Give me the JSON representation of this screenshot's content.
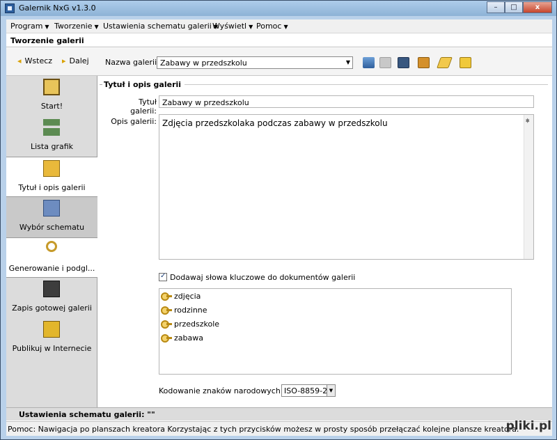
{
  "window": {
    "title": "Galernik NxG v1.3.0",
    "controls": {
      "minimize": "–",
      "maximize": "□",
      "close": "x"
    }
  },
  "menu": [
    {
      "label": "Program"
    },
    {
      "label": "Tworzenie"
    },
    {
      "label": "Ustawienia schematu galerii"
    },
    {
      "label": "Wyświetl"
    },
    {
      "label": "Pomoc"
    }
  ],
  "section_title": "Tworzenie galerii",
  "toolbar": {
    "back_label": "Wstecz",
    "next_label": "Dalej",
    "gallery_name_label": "Nazwa galerii:",
    "gallery_name_value": "Zabawy w przedszkolu",
    "icons": [
      "open-icon",
      "save-disabled-icon",
      "save-icon",
      "package-icon",
      "edit-icon",
      "tag-icon"
    ]
  },
  "sidebar": {
    "items": [
      {
        "label": "Start!",
        "icon": "film-icon"
      },
      {
        "label": "Lista grafik",
        "icon": "image-list-icon"
      },
      {
        "label": "Tytuł i opis galerii",
        "icon": "folder-open-icon"
      },
      {
        "label": "Wybór schematu",
        "icon": "schema-icon"
      },
      {
        "label": "Generowanie i podgl...",
        "icon": "magnifier-icon"
      },
      {
        "label": "Zapis gotowej galerii",
        "icon": "floppy-icon"
      },
      {
        "label": "Publikuj w Internecie",
        "icon": "globe-computer-icon"
      }
    ]
  },
  "form": {
    "group_title": "Tytuł i opis galerii",
    "title_label": "Tytuł galerii:",
    "title_value": "Zabawy w przedszkolu",
    "desc_label": "Opis galerii:",
    "desc_value": "Zdjęcia przedszkolaka podczas zabawy w przedszkolu",
    "keywords_checkbox_label": "Dodawaj słowa kluczowe do dokumentów galerii",
    "keywords_checked": true,
    "keywords": [
      "zdjęcia",
      "rodzinne",
      "przedszkole",
      "zabawa"
    ],
    "encoding_label": "Kodowanie znaków narodowych:",
    "encoding_value": "ISO-8859-2"
  },
  "schema_bar": "Ustawienia schematu galerii: \"\"",
  "status_bar": "Pomoc: Nawigacja po planszach kreatora  Korzystając z tych przycisków możesz w prosty sposób przełączać kolejne plansze kreatora.",
  "watermark": "pliki.pl"
}
